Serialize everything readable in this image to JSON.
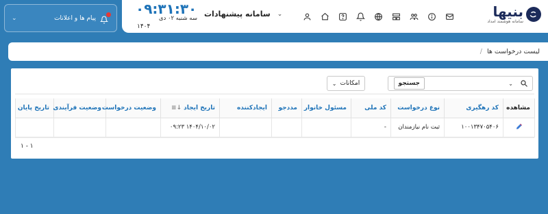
{
  "notifications": {
    "label": "پیام ها و اعلانات"
  },
  "header": {
    "clock": "۰۹:۳۱:۳۰",
    "date": "سه شنبه ۰۲ دی",
    "year": "۱۴۰۴",
    "system_label": "سامانه پیشنهادات",
    "notification_count": "۰",
    "logo_name": "بنیها",
    "logo_subtitle": "سامانه هوشمند امداد"
  },
  "breadcrumb": {
    "current": "لیست درخواست ها",
    "separator": "/"
  },
  "toolbar": {
    "search_placeholder": "",
    "search_button": "جستجو",
    "options_button": "امکانات"
  },
  "table": {
    "columns": [
      "مشاهده",
      "کد رهگیری",
      "نوع درخواست",
      "کد ملی",
      "مسئول خانوار",
      "مددجو",
      "ایجادکننده",
      "تاریخ ایجاد",
      "وضعیت درخواست",
      "وضعیت فرآیندی",
      "تاریخ پایان"
    ],
    "rows": [
      {
        "tracking_code": "۱۰۰۱۳۴۷۰۵۴۰۶",
        "request_type": "ثبت نام نیازمندان",
        "national_code": "-",
        "household_head": "",
        "client": "",
        "creator": "",
        "created_at": "۱۴۰۴/۱۰/۰۲ ۰۹:۲۳",
        "request_status": "",
        "process_status": "",
        "end_date": ""
      }
    ]
  },
  "footer": {
    "count": "۱ - ۱"
  },
  "colors": {
    "background": "#2f7db6",
    "accent": "#1e73b8",
    "alert": "#e53935"
  }
}
